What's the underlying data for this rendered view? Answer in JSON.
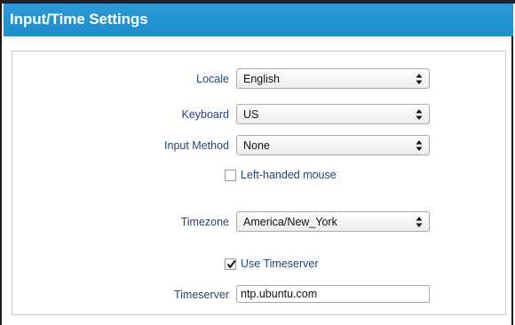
{
  "window": {
    "title": "Input/Time Settings"
  },
  "form": {
    "locale": {
      "label": "Locale",
      "value": "English"
    },
    "keyboard": {
      "label": "Keyboard",
      "value": "US"
    },
    "input_method": {
      "label": "Input Method",
      "value": "None"
    },
    "left_handed": {
      "label": "Left-handed mouse",
      "checked": false
    },
    "timezone": {
      "label": "Timezone",
      "value": "America/New_York"
    },
    "use_timeserver": {
      "label": "Use Timeserver",
      "checked": true
    },
    "timeserver": {
      "label": "Timeserver",
      "value": "ntp.ubuntu.com"
    }
  },
  "icons": {
    "dropdown": "updown-arrows-icon",
    "check": "checkmark-icon"
  },
  "colors": {
    "titlebar": "#2a9bd6",
    "label_text": "#24457a"
  }
}
